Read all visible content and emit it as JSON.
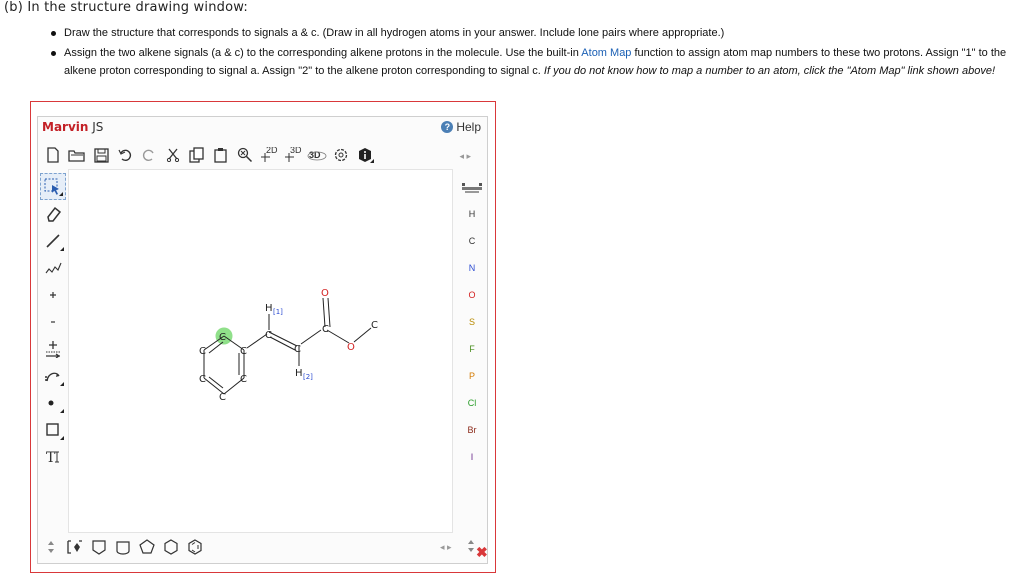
{
  "heading": "(b) In the structure drawing window:",
  "instructions": {
    "bullet1": "Draw the structure that corresponds to signals a & c. (Draw in all hydrogen atoms in your answer. Include lone pairs where appropriate.)",
    "bullet2_pre": "Assign the two alkene signals (a & c) to the corresponding alkene protons in the molecule. Use the built-in ",
    "bullet2_link": "Atom Map",
    "bullet2_mid": " function to assign atom map numbers to these two protons. Assign \"1\" to the alkene proton corresponding to signal a. Assign \"2\" to the alkene proton corresponding to signal c. ",
    "bullet2_italic": "If you do not know how to map a number to an atom, click the \"Atom Map\" link shown above!"
  },
  "editor": {
    "brand": "Marvin",
    "brand_suffix": " JS",
    "help_label": "Help",
    "toolbar_top": {
      "label_2d": "2D",
      "label_3d": "3D",
      "label_3d_b": "3D"
    },
    "elements": [
      "H",
      "C",
      "N",
      "O",
      "S",
      "F",
      "P",
      "Cl",
      "Br",
      "I"
    ],
    "colors": {
      "brand": "#c32026",
      "frame": "#d9383a",
      "oxygen": "#d32020",
      "map_number": "#2b4bd1",
      "highlight": "#90e08a"
    },
    "molecule": {
      "ring_atoms": [
        "C",
        "C",
        "C",
        "C",
        "C",
        "C"
      ],
      "atom_c7": "C",
      "atom_c8": "C",
      "atom_c9": "C",
      "atom_o_carbonyl": "O",
      "atom_o_ester": "O",
      "atom_c_methyl": "C",
      "h1_symbol": "H",
      "h1_map": "[1]",
      "h2_symbol": "H",
      "h2_map": "[2]"
    }
  }
}
